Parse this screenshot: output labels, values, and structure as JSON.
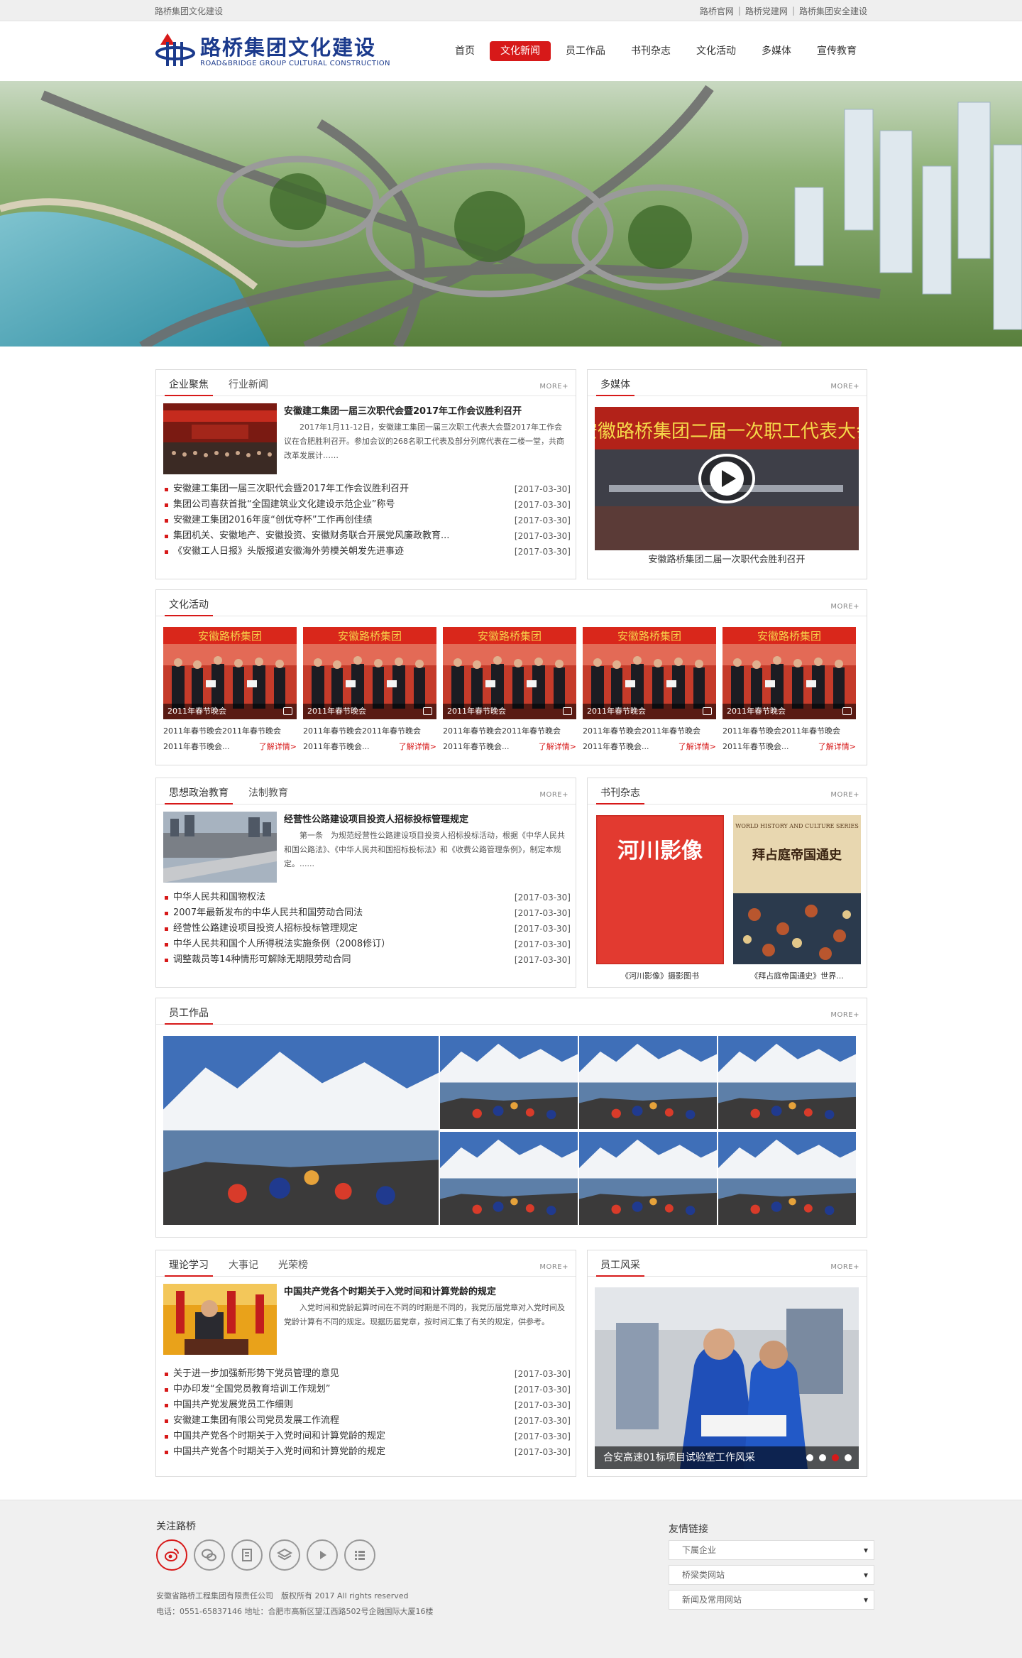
{
  "topbar": {
    "site": "路桥集团文化建设",
    "links": [
      "路桥官网",
      "路桥党建网",
      "路桥集团安全建设"
    ]
  },
  "header": {
    "logo_cn": "路桥集团文化建设",
    "logo_en": "ROAD&BRIDGE GROUP CULTURAL CONSTRUCTION",
    "nav": [
      "首页",
      "文化新闻",
      "员工作品",
      "书刊杂志",
      "文化活动",
      "多媒体",
      "宣传教育"
    ],
    "active_nav": "文化新闻"
  },
  "more": "MORE+",
  "news": {
    "tabs": [
      "企业聚焦",
      "行业新闻"
    ],
    "feature": {
      "title": "安徽建工集团一届三次职代会暨2017年工作会议胜利召开",
      "summary": "2017年1月11-12日，安徽建工集团一届三次职工代表大会暨2017年工作会议在合肥胜利召开。参加会议的268名职工代表及部分列席代表在二楼一堂，共商改革发展计……"
    },
    "items": [
      {
        "title": "安徽建工集团一届三次职代会暨2017年工作会议胜利召开",
        "date": "[2017-03-30]"
      },
      {
        "title": "集团公司喜获首批“全国建筑业文化建设示范企业”称号",
        "date": "[2017-03-30]"
      },
      {
        "title": "安徽建工集团2016年度“创优夺杯”工作再创佳绩",
        "date": "[2017-03-30]"
      },
      {
        "title": "集团机关、安徽地产、安徽投资、安徽财务联合开展党风廉政教育...",
        "date": "[2017-03-30]"
      },
      {
        "title": "《安徽工人日报》头版报道安徽海外劳模关朝发先进事迹",
        "date": "[2017-03-30]"
      }
    ]
  },
  "media": {
    "title": "多媒体",
    "video_banner": "安徽路桥集团二届一次职工代表大会",
    "caption": "安徽路桥集团二届一次职代会胜利召开"
  },
  "activity": {
    "title": "文化活动",
    "items": [
      {
        "label": "2011年春节晚会",
        "t1": "2011年春节晚会2011年春节晚会",
        "t2": "2011年春节晚会...",
        "link": "了解详情>"
      },
      {
        "label": "2011年春节晚会",
        "t1": "2011年春节晚会2011年春节晚会",
        "t2": "2011年春节晚会...",
        "link": "了解详情>"
      },
      {
        "label": "2011年春节晚会",
        "t1": "2011年春节晚会2011年春节晚会",
        "t2": "2011年春节晚会...",
        "link": "了解详情>"
      },
      {
        "label": "2011年春节晚会",
        "t1": "2011年春节晚会2011年春节晚会",
        "t2": "2011年春节晚会...",
        "link": "了解详情>"
      },
      {
        "label": "2011年春节晚会",
        "t1": "2011年春节晚会2011年春节晚会",
        "t2": "2011年春节晚会...",
        "link": "了解详情>"
      }
    ],
    "banner_text": "安徽路桥集团"
  },
  "education": {
    "tabs": [
      "思想政治教育",
      "法制教育"
    ],
    "feature": {
      "title": "经营性公路建设项目投资人招标投标管理规定",
      "summary": "第一条　为规范经营性公路建设项目投资人招标投标活动，根据《中华人民共和国公路法》、《中华人民共和国招标投标法》和《收费公路管理条例》，制定本规定。......"
    },
    "items": [
      {
        "title": "中华人民共和国物权法",
        "date": "[2017-03-30]"
      },
      {
        "title": "2007年最新发布的中华人民共和国劳动合同法",
        "date": "[2017-03-30]"
      },
      {
        "title": "经营性公路建设项目投资人招标投标管理规定",
        "date": "[2017-03-30]"
      },
      {
        "title": "中华人民共和国个人所得税法实施条例（2008修订）",
        "date": "[2017-03-30]"
      },
      {
        "title": "调整裁员等14种情形可解除无期限劳动合同",
        "date": "[2017-03-30]"
      }
    ]
  },
  "books": {
    "title": "书刊杂志",
    "items": [
      {
        "cover": "河川影像",
        "caption": "《河川影像》摄影图书"
      },
      {
        "cover": "拜占庭帝国通史",
        "series": "WORLD HISTORY AND CULTURE SERIES",
        "caption": "《拜占庭帝国通史》世界..."
      }
    ]
  },
  "works": {
    "title": "员工作品"
  },
  "theory": {
    "tabs": [
      "理论学习",
      "大事记",
      "光荣榜"
    ],
    "feature": {
      "title": "中国共产党各个时期关于入党时间和计算党龄的规定",
      "summary": "入党时间和党龄起算时间在不同的时期是不同的，我党历届党章对入党时间及党龄计算有不同的规定。现据历届党章，按时间汇集了有关的规定，供参考。"
    },
    "items": [
      {
        "title": "关于进一步加强新形势下党员管理的意见",
        "date": "[2017-03-30]"
      },
      {
        "title": "中办印发“全国党员教育培训工作规划”",
        "date": "[2017-03-30]"
      },
      {
        "title": "中国共产党发展党员工作细则",
        "date": "[2017-03-30]"
      },
      {
        "title": "安徽建工集团有限公司党员发展工作流程",
        "date": "[2017-03-30]"
      },
      {
        "title": "中国共产党各个时期关于入党时间和计算党龄的规定",
        "date": "[2017-03-30]"
      },
      {
        "title": "中国共产党各个时期关于入党时间和计算党龄的规定",
        "date": "[2017-03-30]"
      }
    ]
  },
  "staff": {
    "title": "员工风采",
    "caption": "合安高速01标项目试验室工作风采",
    "dots": 4,
    "active_dot": 2
  },
  "footer": {
    "follow": "关注路桥",
    "friends": "友情链接",
    "selects": [
      "下属企业",
      "桥梁类网站",
      "新闻及常用网站"
    ],
    "copyright": "安徽省路桥工程集团有限责任公司　版权所有 2017 All rights reserved",
    "contact": "电话：0551-65837146 地址：合肥市高新区望江西路502号企融国际大厦16楼"
  },
  "colors": {
    "accent": "#d71919",
    "brand_blue": "#1b3a8c"
  }
}
